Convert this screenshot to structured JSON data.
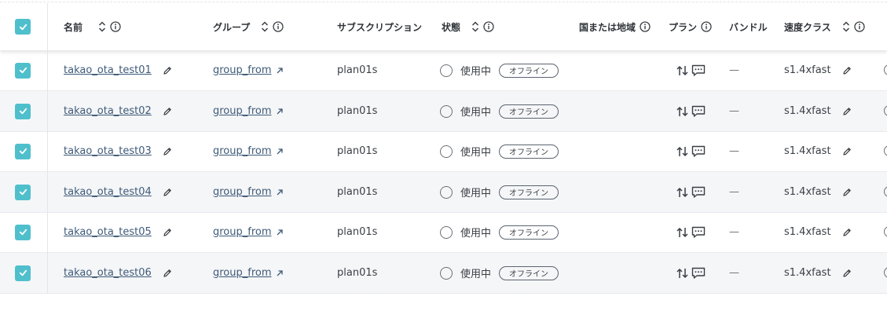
{
  "columns": {
    "name": "名前",
    "group": "グループ",
    "subscription": "サブスクリプション",
    "status": "状態",
    "region": "国または地域",
    "plan": "プラン",
    "bundle": "バンドル",
    "speed": "速度クラス"
  },
  "rows": [
    {
      "checked": true,
      "name": "takao_ota_test01",
      "group": "group_from",
      "subscription": "plan01s",
      "status": "使用中",
      "badge": "オフライン",
      "bundle": "—",
      "speed": "s1.4xfast"
    },
    {
      "checked": true,
      "name": "takao_ota_test02",
      "group": "group_from",
      "subscription": "plan01s",
      "status": "使用中",
      "badge": "オフライン",
      "bundle": "—",
      "speed": "s1.4xfast"
    },
    {
      "checked": true,
      "name": "takao_ota_test03",
      "group": "group_from",
      "subscription": "plan01s",
      "status": "使用中",
      "badge": "オフライン",
      "bundle": "—",
      "speed": "s1.4xfast"
    },
    {
      "checked": true,
      "name": "takao_ota_test04",
      "group": "group_from",
      "subscription": "plan01s",
      "status": "使用中",
      "badge": "オフライン",
      "bundle": "—",
      "speed": "s1.4xfast"
    },
    {
      "checked": true,
      "name": "takao_ota_test05",
      "group": "group_from",
      "subscription": "plan01s",
      "status": "使用中",
      "badge": "オフライン",
      "bundle": "—",
      "speed": "s1.4xfast"
    },
    {
      "checked": true,
      "name": "takao_ota_test06",
      "group": "group_from",
      "subscription": "plan01s",
      "status": "使用中",
      "badge": "オフライン",
      "bundle": "—",
      "speed": "s1.4xfast"
    }
  ],
  "icons": {
    "select_all": "checkbox-checked-icon",
    "sort": "sort-updown-icon",
    "info": "info-circle-icon",
    "edit": "pencil-icon",
    "external": "external-link-arrow-icon",
    "plan_swap": "swap-updown-arrows-icon",
    "plan_chat": "chat-bubble-icon"
  },
  "colors": {
    "checkbox": "#4fbfcc",
    "link": "#3e5a78",
    "row_alt": "#f5f6f8"
  }
}
